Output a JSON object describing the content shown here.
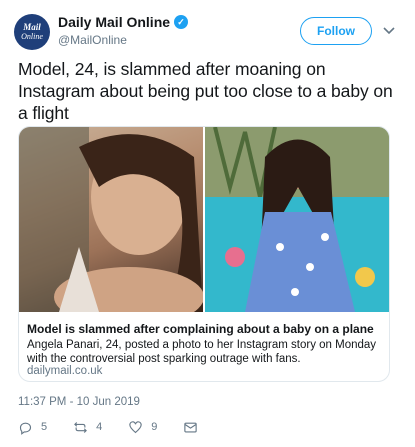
{
  "author": {
    "avatar_line1": "Mail",
    "avatar_line2": "Online",
    "name": "Daily Mail Online",
    "verified_icon": "verified-badge-icon",
    "handle": "@MailOnline"
  },
  "header": {
    "follow_label": "Follow",
    "caret_icon": "chevron-down-icon"
  },
  "tweet": {
    "text": "Model, 24, is slammed after moaning on Instagram about being put too close to a baby on a flight",
    "timestamp": "11:37 PM - 10 Jun 2019"
  },
  "card": {
    "title": "Model is slammed after complaining about a baby on a plane",
    "description": "Angela Panari, 24, posted a photo to her Instagram story on Monday with the controversial post sparking outrage with fans.",
    "domain": "dailymail.co.uk"
  },
  "actions": {
    "reply_count": "5",
    "retweet_count": "4",
    "like_count": "9"
  },
  "colors": {
    "accent": "#1da1f2",
    "muted": "#657786",
    "brand": "#1f3f7a"
  }
}
